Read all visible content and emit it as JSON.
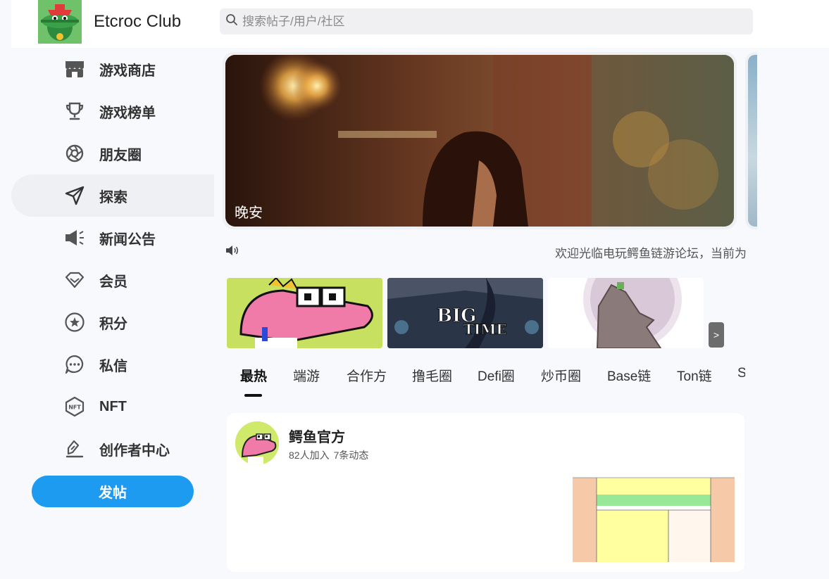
{
  "header": {
    "app_title": "Etcroc Club",
    "search_placeholder": "搜索帖子/用户/社区"
  },
  "sidebar": {
    "items": [
      {
        "label": "游戏商店",
        "icon": "store-icon"
      },
      {
        "label": "游戏榜单",
        "icon": "trophy-icon"
      },
      {
        "label": "朋友圈",
        "icon": "aperture-icon"
      },
      {
        "label": "探索",
        "icon": "send-icon"
      },
      {
        "label": "新闻公告",
        "icon": "megaphone-icon"
      },
      {
        "label": "会员",
        "icon": "diamond-icon"
      },
      {
        "label": "积分",
        "icon": "star-circle-icon"
      },
      {
        "label": "私信",
        "icon": "chat-bubble-icon"
      },
      {
        "label": "NFT",
        "icon": "nft-icon"
      },
      {
        "label": "创作者中心",
        "icon": "pen-icon"
      }
    ],
    "active_index": 3,
    "post_button": "发帖"
  },
  "banner": {
    "caption": "晚安"
  },
  "notice": {
    "text": "欢迎光临电玩鳄鱼链游论坛，当前为"
  },
  "thumbnails": [
    {
      "name": "pink-crocodile-thumb"
    },
    {
      "name": "big-time-thumb"
    },
    {
      "name": "pixel-creature-thumb"
    }
  ],
  "tabs": {
    "items": [
      "最热",
      "端游",
      "合作方",
      "撸毛圈",
      "Defi圈",
      "炒币圈",
      "Base链",
      "Ton链",
      "S"
    ],
    "active_index": 0
  },
  "post_card": {
    "name": "鳄鱼官方",
    "members": "82人加入",
    "posts": "7条动态"
  },
  "colors": {
    "accent": "#1d9bf0",
    "background": "#f7f9fc"
  }
}
